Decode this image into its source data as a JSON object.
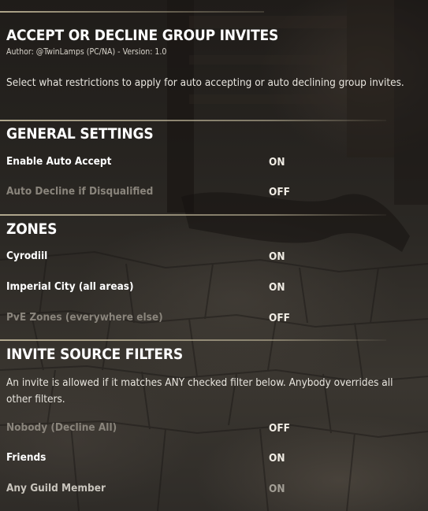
{
  "addon": {
    "title": "ACCEPT OR DECLINE GROUP INVITES",
    "author_line": "Author: @TwinLamps (PC/NA) - Version: 1.0",
    "description": "Select what restrictions to apply for auto accepting or auto declining group invites."
  },
  "sections": {
    "general": {
      "title": "GENERAL SETTINGS",
      "items": [
        {
          "label": "Enable Auto Accept",
          "value": "ON"
        },
        {
          "label": "Auto Decline if Disqualified",
          "value": "OFF"
        }
      ]
    },
    "zones": {
      "title": "ZONES",
      "items": [
        {
          "label": "Cyrodiil",
          "value": "ON"
        },
        {
          "label": "Imperial City (all areas)",
          "value": "ON"
        },
        {
          "label": "PvE Zones (everywhere else)",
          "value": "OFF"
        }
      ]
    },
    "invite_filters": {
      "title": "INVITE SOURCE FILTERS",
      "description": "An invite is allowed if it matches ANY checked filter below. Anybody overrides all other filters.",
      "items": [
        {
          "label": "Nobody (Decline All)",
          "value": "OFF"
        },
        {
          "label": "Friends",
          "value": "ON"
        },
        {
          "label": "Any Guild Member",
          "value": "ON"
        }
      ]
    }
  },
  "colors": {
    "text_primary": "#ffffff",
    "text_disabled": "#8a857c",
    "divider": "#c8be a0"
  }
}
